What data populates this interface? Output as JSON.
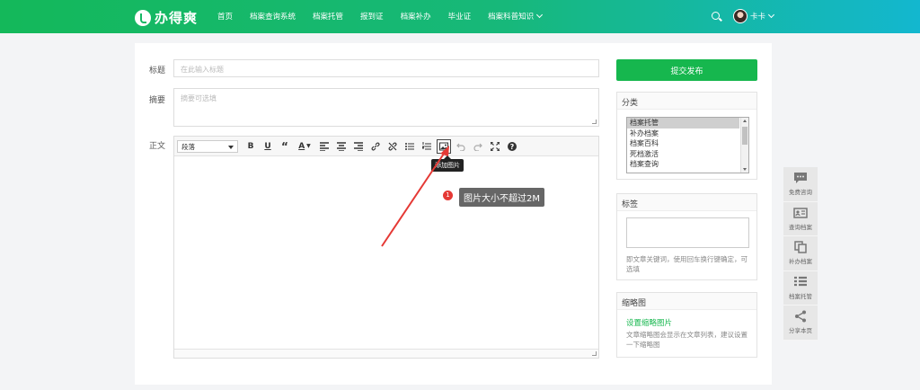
{
  "header": {
    "logo": "办得爽",
    "nav": [
      "首页",
      "档案查询系统",
      "档案托管",
      "报到证",
      "档案补办",
      "毕业证",
      "档案科普知识"
    ],
    "user_name": "卡卡"
  },
  "form": {
    "title_label": "标题",
    "title_placeholder": "在此输入标题",
    "summary_label": "摘要",
    "summary_placeholder": "摘要可选填",
    "body_label": "正文",
    "paragraph_select": "段落",
    "add_image_tooltip": "添加图片",
    "tip_number": "1",
    "tip_text": "图片大小不超过2M"
  },
  "sidebar": {
    "submit_label": "提交发布",
    "category_title": "分类",
    "categories": [
      "档案托管",
      "补办档案",
      "档案百科",
      "死档激活",
      "档案查询"
    ],
    "selected_category": "档案托管",
    "tags_title": "标签",
    "tags_help": "即文章关键词，使用回车换行键确定，可选填",
    "thumbnail_title": "缩略图",
    "thumbnail_link": "设置缩略图片",
    "thumbnail_help": "文章缩略图会显示在文章列表，建议设置一下缩略图"
  },
  "side_tools": [
    "免费咨询",
    "查询档案",
    "补办档案",
    "档案托管",
    "分享本页"
  ],
  "colors": {
    "header_start": "#14b85a",
    "header_end": "#13b7cf",
    "accent": "#16b74e",
    "tip_dot": "#e53935"
  }
}
